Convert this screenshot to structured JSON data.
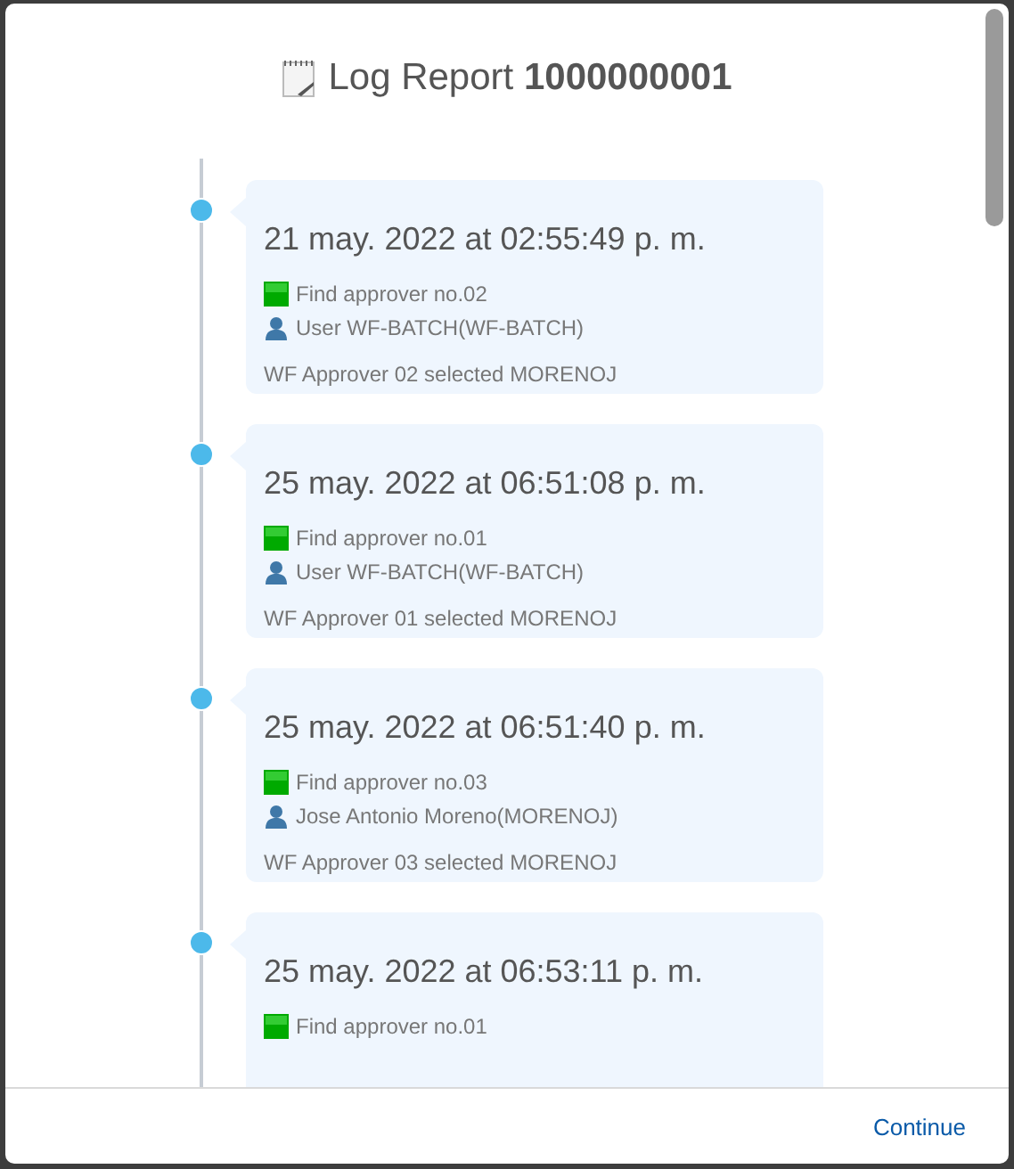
{
  "dialog": {
    "title": "Log Report",
    "number": "1000000001"
  },
  "entries": [
    {
      "time": "21 may. 2022 at 02:55:49 p. m.",
      "lines": [
        {
          "kind": "step",
          "text": "Find approver no.02"
        },
        {
          "kind": "user",
          "text": "User WF-BATCH(WF-BATCH)"
        }
      ],
      "note": "WF Approver 02 selected MORENOJ"
    },
    {
      "time": "25 may. 2022 at 06:51:08 p. m.",
      "lines": [
        {
          "kind": "step",
          "text": "Find approver no.01"
        },
        {
          "kind": "user",
          "text": "User WF-BATCH(WF-BATCH)"
        }
      ],
      "note": "WF Approver 01 selected MORENOJ"
    },
    {
      "time": "25 may. 2022 at 06:51:40 p. m.",
      "lines": [
        {
          "kind": "step",
          "text": "Find approver no.03"
        },
        {
          "kind": "user",
          "text": "Jose Antonio Moreno(MORENOJ)"
        }
      ],
      "note": "WF Approver 03 selected MORENOJ"
    },
    {
      "time": "25 may. 2022 at 06:53:11 p. m.",
      "lines": [
        {
          "kind": "step",
          "text": "Find approver no.01"
        }
      ]
    }
  ],
  "footer": {
    "button": "Continue"
  }
}
